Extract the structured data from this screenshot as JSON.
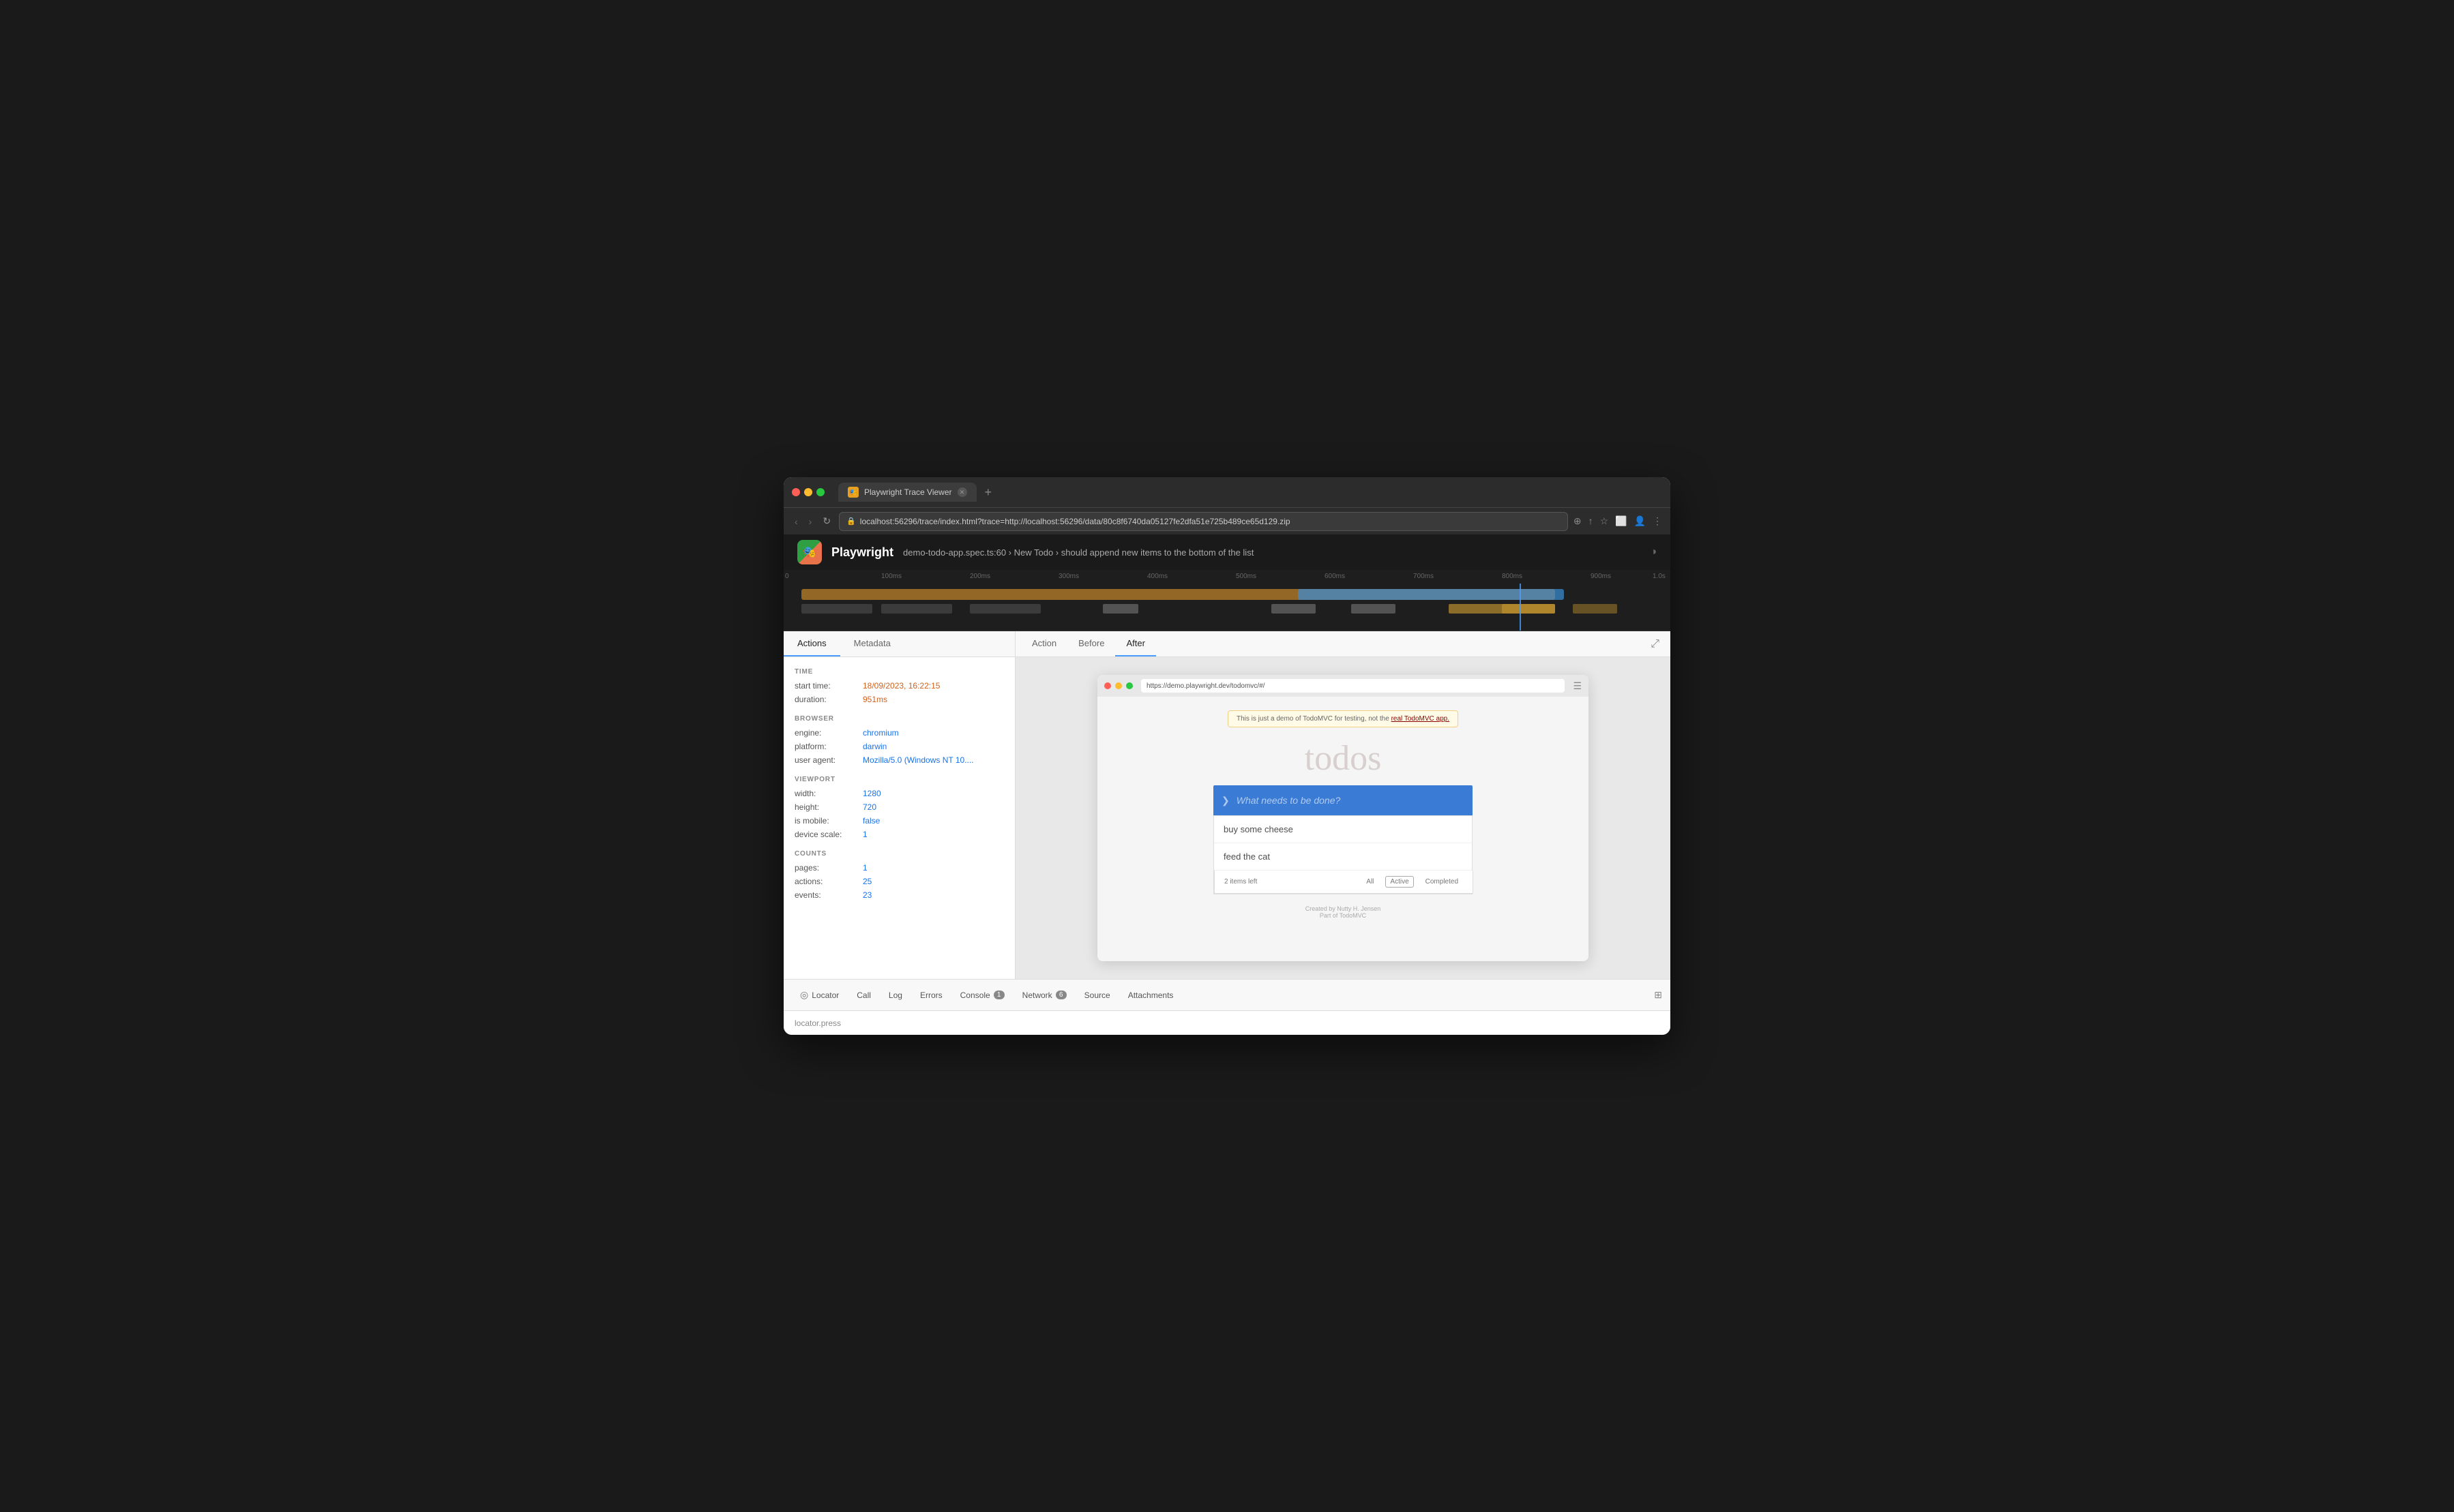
{
  "window": {
    "title": "Playwright Trace Viewer",
    "tab_label": "Playwright Trace Viewer",
    "url": "localhost:56296/trace/index.html?trace=http://localhost:56296/data/80c8f6740da05127fe2dfa51e725b489ce65d129.zip"
  },
  "header": {
    "app_name": "Playwright",
    "breadcrumb": "demo-todo-app.spec.ts:60 › New Todo › should append new items to the bottom of the list"
  },
  "timeline": {
    "ticks": [
      "0",
      "100ms",
      "200ms",
      "300ms",
      "400ms",
      "500ms",
      "600ms",
      "700ms",
      "800ms",
      "900ms",
      "1.0s"
    ]
  },
  "left_panel": {
    "tabs": [
      "Actions",
      "Metadata"
    ],
    "active_tab": "Actions",
    "sections": {
      "time": {
        "label": "TIME",
        "rows": [
          {
            "key": "start time:",
            "value": "18/09/2023, 16:22:15",
            "color": "orange"
          },
          {
            "key": "duration:",
            "value": "951ms",
            "color": "orange"
          }
        ]
      },
      "browser": {
        "label": "BROWSER",
        "rows": [
          {
            "key": "engine:",
            "value": "chromium",
            "color": "blue"
          },
          {
            "key": "platform:",
            "value": "darwin",
            "color": "blue"
          },
          {
            "key": "user agent:",
            "value": "Mozilla/5.0 (Windows NT 10....",
            "color": "blue"
          }
        ]
      },
      "viewport": {
        "label": "VIEWPORT",
        "rows": [
          {
            "key": "width:",
            "value": "1280",
            "color": "blue"
          },
          {
            "key": "height:",
            "value": "720",
            "color": "blue"
          },
          {
            "key": "is mobile:",
            "value": "false",
            "color": "blue"
          },
          {
            "key": "device scale:",
            "value": "1",
            "color": "blue"
          }
        ]
      },
      "counts": {
        "label": "COUNTS",
        "rows": [
          {
            "key": "pages:",
            "value": "1",
            "color": "blue"
          },
          {
            "key": "actions:",
            "value": "25",
            "color": "blue"
          },
          {
            "key": "events:",
            "value": "23",
            "color": "blue"
          }
        ]
      }
    }
  },
  "view_tabs": {
    "tabs": [
      "Action",
      "Before",
      "After"
    ],
    "active_tab": "After"
  },
  "browser_preview": {
    "url": "https://demo.playwright.dev/todomvc/#/",
    "banner_text": "This is just a demo of TodoMVC for testing, not the",
    "banner_link": "real TodoMVC app.",
    "title": "todos",
    "input_placeholder": "What needs to be done?",
    "items": [
      "buy some cheese",
      "feed the cat"
    ],
    "footer": {
      "count": "2 items left",
      "buttons": [
        "All",
        "Active",
        "Completed"
      ]
    },
    "footer_credit": "Created by Nutty H. Jensen\nPart of TodoMVC"
  },
  "bottom_tabs": {
    "tabs": [
      {
        "label": "Locator",
        "icon": "target",
        "badge": null
      },
      {
        "label": "Call",
        "icon": null,
        "badge": null
      },
      {
        "label": "Log",
        "icon": null,
        "badge": null
      },
      {
        "label": "Errors",
        "icon": null,
        "badge": null
      },
      {
        "label": "Console",
        "icon": null,
        "badge": "1"
      },
      {
        "label": "Network",
        "icon": null,
        "badge": "6"
      },
      {
        "label": "Source",
        "icon": null,
        "badge": null
      },
      {
        "label": "Attachments",
        "icon": null,
        "badge": null
      }
    ]
  },
  "status_bar": {
    "text": "locator.press"
  }
}
